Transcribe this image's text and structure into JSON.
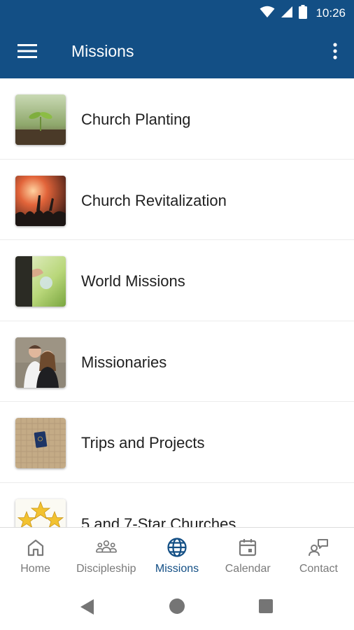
{
  "status_bar": {
    "time": "10:26",
    "icons": [
      "wifi-icon",
      "cell-signal-icon",
      "battery-icon"
    ]
  },
  "app_bar": {
    "title": "Missions",
    "background": "#134f85",
    "icons": [
      "menu-icon",
      "more-vert-icon"
    ]
  },
  "list": {
    "items": [
      {
        "label": "Church Planting",
        "thumbnail": "seedling-photo"
      },
      {
        "label": "Church Revitalization",
        "thumbnail": "worship-concert-photo"
      },
      {
        "label": "World Missions",
        "thumbnail": "person-holding-globe-photo"
      },
      {
        "label": "Missionaries",
        "thumbnail": "couple-portrait-photo"
      },
      {
        "label": "Trips and Projects",
        "thumbnail": "passport-on-burlap-photo"
      },
      {
        "label": "5 and 7-Star Churches",
        "thumbnail": "gold-stars-graphic"
      }
    ]
  },
  "bottom_nav": {
    "active_color": "#134f85",
    "inactive_color": "#7a7a7a",
    "items": [
      {
        "label": "Home",
        "icon": "home-icon",
        "active": false
      },
      {
        "label": "Discipleship",
        "icon": "people-group-icon",
        "active": false
      },
      {
        "label": "Missions",
        "icon": "globe-icon",
        "active": true
      },
      {
        "label": "Calendar",
        "icon": "calendar-icon",
        "active": false
      },
      {
        "label": "Contact",
        "icon": "contact-icon",
        "active": false
      }
    ]
  },
  "system_nav": {
    "icons": [
      "back-icon",
      "home-circle-icon",
      "recents-icon"
    ]
  }
}
